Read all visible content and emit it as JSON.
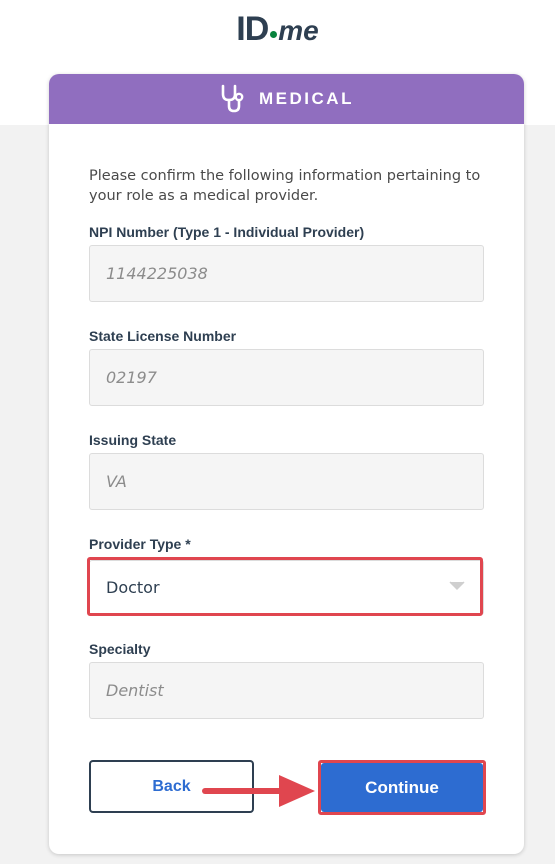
{
  "logo": {
    "id_text": "ID",
    "me_text": "me"
  },
  "card": {
    "header_title": "MEDICAL",
    "header_icon": "stethoscope-icon"
  },
  "intro": "Please confirm the following information pertaining to your role as a medical provider.",
  "fields": [
    {
      "label": "NPI Number (Type 1 - Individual Provider)",
      "value": "1144225038"
    },
    {
      "label": "State License Number",
      "value": "02197"
    },
    {
      "label": "Issuing State",
      "value": "VA"
    },
    {
      "label": "Specialty",
      "value": "Dentist"
    }
  ],
  "provider_type": {
    "label": "Provider Type *",
    "value": "Doctor"
  },
  "buttons": {
    "back": "Back",
    "continue": "Continue"
  },
  "colors": {
    "header": "#906ebf",
    "primary": "#2d6cd1",
    "highlight": "#e0464f",
    "brand_dot": "#08833d"
  }
}
